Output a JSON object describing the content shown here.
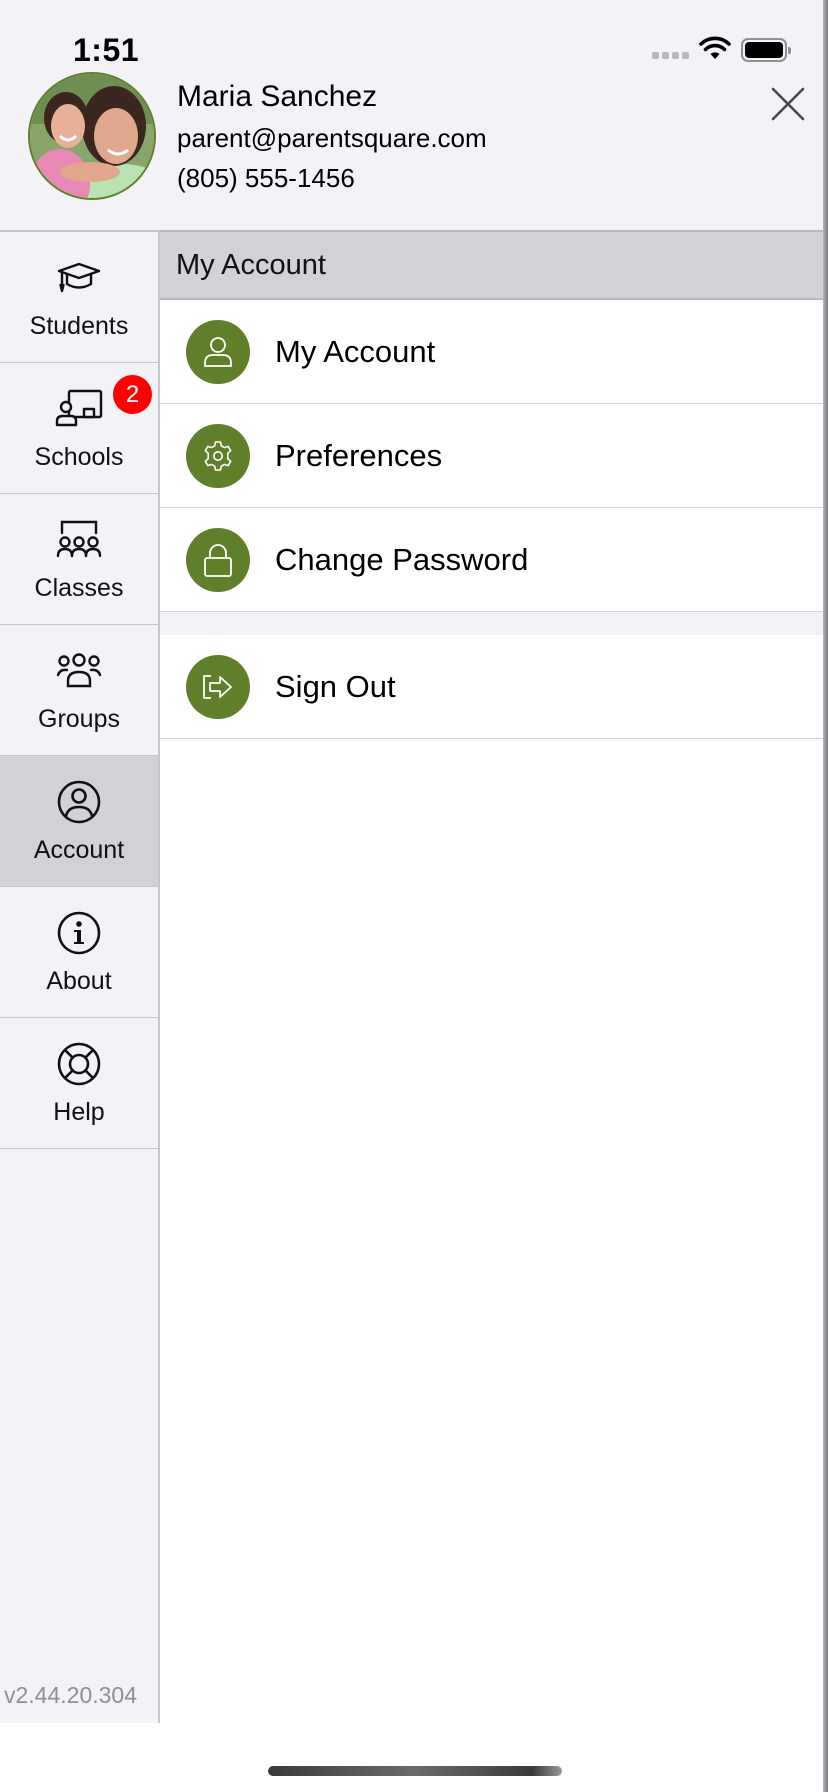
{
  "status_bar": {
    "time": "1:51",
    "icons": [
      "cellular-no-signal-icon",
      "wifi-icon",
      "battery-icon"
    ]
  },
  "profile": {
    "name": "Maria Sanchez",
    "email": "parent@parentsquare.com",
    "phone": "(805) 555-1456",
    "avatar": "avatar-photo",
    "close_icon": "close-icon"
  },
  "sidebar": {
    "items": [
      {
        "label": "Students",
        "icon": "graduation-cap-icon",
        "active": false
      },
      {
        "label": "Schools",
        "icon": "school-presenter-icon",
        "active": false,
        "badge": "2"
      },
      {
        "label": "Classes",
        "icon": "classroom-icon",
        "active": false
      },
      {
        "label": "Groups",
        "icon": "group-icon",
        "active": false
      },
      {
        "label": "Account",
        "icon": "account-circle-icon",
        "active": true
      },
      {
        "label": "About",
        "icon": "info-icon",
        "active": false
      },
      {
        "label": "Help",
        "icon": "lifebuoy-icon",
        "active": false
      }
    ],
    "version": "v2.44.20.304"
  },
  "content": {
    "section_title": "My Account",
    "rows": [
      {
        "label": "My Account",
        "icon": "person-icon"
      },
      {
        "label": "Preferences",
        "icon": "gear-icon"
      },
      {
        "label": "Change Password",
        "icon": "lock-icon"
      }
    ],
    "sign_out": {
      "label": "Sign Out",
      "icon": "sign-out-icon"
    }
  },
  "colors": {
    "accent_green": "#5f7f2a",
    "badge_red": "#fe0000",
    "sidebar_bg": "#f2f2f7",
    "active_bg": "#d1d1d6"
  }
}
